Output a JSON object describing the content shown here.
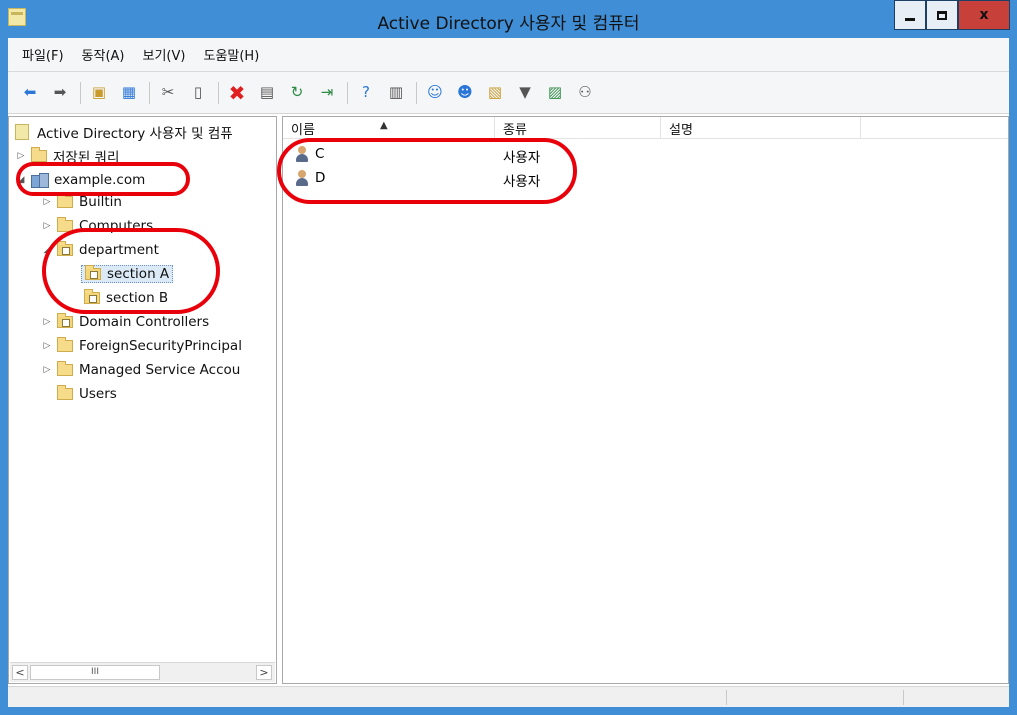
{
  "window": {
    "title": "Active Directory 사용자 및 컴퓨터",
    "controls": {
      "minimize": "minimize",
      "maximize": "maximize",
      "close": "x"
    }
  },
  "menu": [
    "파일(F)",
    "동작(A)",
    "보기(V)",
    "도움말(H)"
  ],
  "toolbar": {
    "icons": [
      "back-arrow",
      "forward-arrow",
      "up-folder",
      "show-console-tree",
      "cut",
      "copy",
      "delete",
      "properties",
      "refresh",
      "export-list",
      "help",
      "show-action-pane",
      "create-user",
      "create-group",
      "create-ou",
      "filter",
      "add-to-group",
      "delegate-control"
    ]
  },
  "tree": {
    "root": "Active Directory 사용자 및 컴퓨",
    "items": [
      {
        "label": "저장된 쿼리",
        "expander": "collapsed",
        "icon": "folder"
      },
      {
        "label": "example.com",
        "expander": "expanded",
        "icon": "domain"
      },
      {
        "label": "Builtin",
        "expander": "collapsed",
        "icon": "folder"
      },
      {
        "label": "Computers",
        "expander": "collapsed",
        "icon": "folder"
      },
      {
        "label": "department",
        "expander": "expanded",
        "icon": "ou"
      },
      {
        "label": "section A",
        "expander": "none",
        "icon": "ou",
        "selected": true
      },
      {
        "label": "section B",
        "expander": "none",
        "icon": "ou"
      },
      {
        "label": "Domain Controllers",
        "expander": "collapsed",
        "icon": "ou"
      },
      {
        "label": "ForeignSecurityPrincipal",
        "expander": "collapsed",
        "icon": "folder"
      },
      {
        "label": "Managed Service Accou",
        "expander": "collapsed",
        "icon": "folder"
      },
      {
        "label": "Users",
        "expander": "none",
        "icon": "folder"
      }
    ],
    "scrollbar": {
      "left": "<",
      "thumb": "III",
      "right": ">"
    }
  },
  "list": {
    "columns": [
      "이름",
      "종류",
      "설명"
    ],
    "sorted_column": "이름",
    "rows": [
      {
        "name": "C",
        "type": "사용자",
        "description": ""
      },
      {
        "name": "D",
        "type": "사용자",
        "description": ""
      }
    ]
  },
  "colors": {
    "titlebar": "#3f8ed6",
    "annotation": "#e8000b",
    "close_button": "#c7413a"
  }
}
